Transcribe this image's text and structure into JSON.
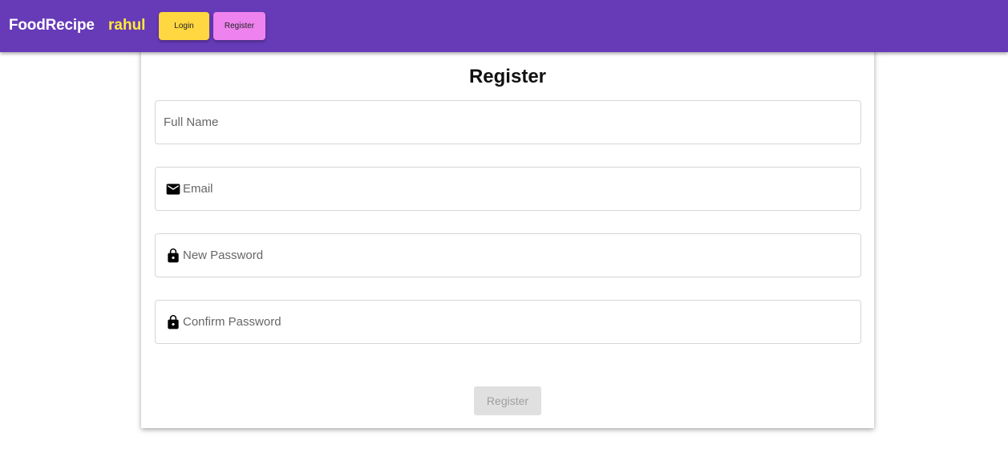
{
  "header": {
    "brand": "FoodRecipe",
    "username": "rahul",
    "login_label": "Login",
    "register_label": "Register",
    "colors": {
      "bar": "#673ab7",
      "username": "#ffeb3b",
      "login_button": "#ffd740",
      "register_button": "#ee82ee"
    }
  },
  "form": {
    "title": "Register",
    "fields": [
      {
        "name": "full-name",
        "placeholder": "Full Name",
        "value": "",
        "icon": null
      },
      {
        "name": "email",
        "placeholder": "Email",
        "value": "",
        "icon": "mail-icon"
      },
      {
        "name": "new-password",
        "placeholder": "New Password",
        "value": "",
        "icon": "lock-icon"
      },
      {
        "name": "confirm-password",
        "placeholder": "Confirm Password",
        "value": "",
        "icon": "lock-icon"
      }
    ],
    "submit_label": "Register",
    "submit_state": "disabled"
  }
}
